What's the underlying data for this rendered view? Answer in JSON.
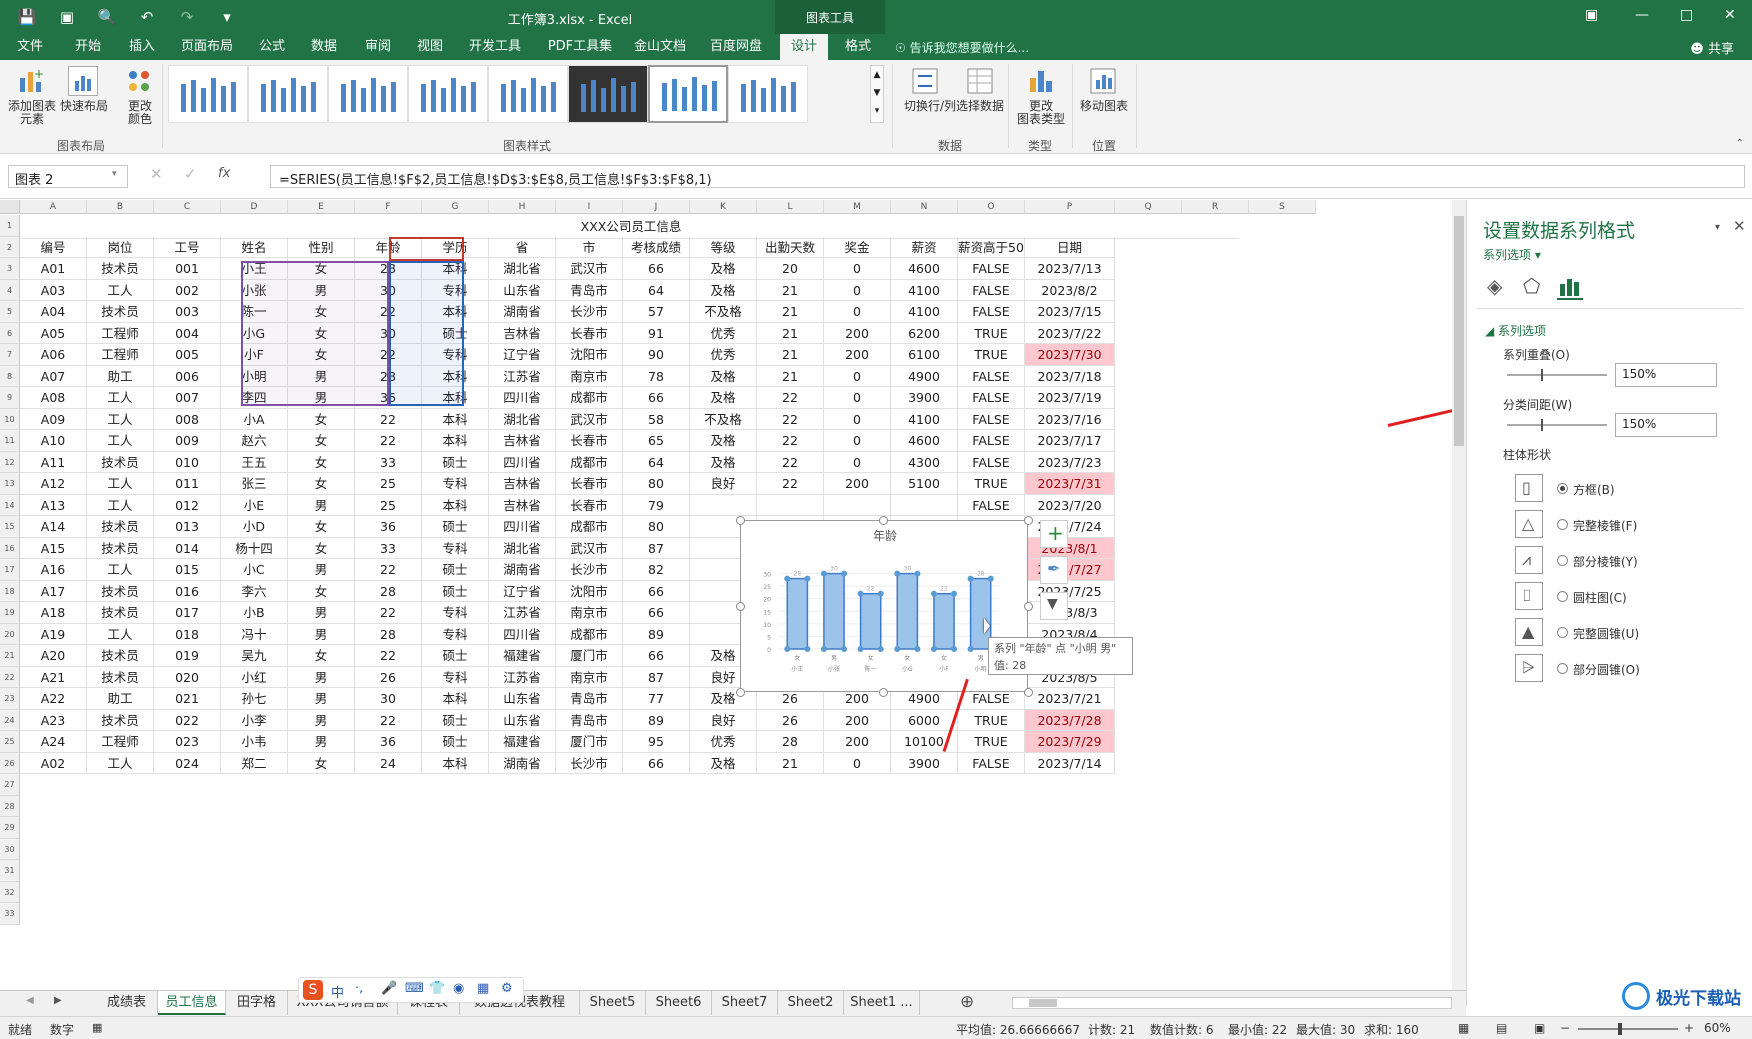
{
  "titlebar": {
    "doc_title": "工作簿3.xlsx - Excel",
    "context_tools": "图表工具"
  },
  "menu": [
    "文件",
    "开始",
    "插入",
    "页面布局",
    "公式",
    "数据",
    "审阅",
    "视图",
    "开发工具",
    "PDF工具集",
    "金山文档",
    "百度网盘",
    "设计",
    "格式"
  ],
  "tell_me": "告诉我您想要做什么...",
  "share": "共享",
  "ribbon": {
    "add_element": "添加图表\n元素",
    "quick_layout": "快速布局",
    "change_colors": "更改\n颜色",
    "group_layout": "图表布局",
    "group_styles": "图表样式",
    "switch_rowcol": "切换行/列",
    "select_data": "选择数据",
    "group_data": "数据",
    "change_type": "更改\n图表类型",
    "group_type": "类型",
    "move_chart": "移动图表",
    "group_location": "位置"
  },
  "formula": {
    "name_box": "图表 2",
    "fx": "fx",
    "text": "=SERIES(员工信息!$F$2,员工信息!$D$3:$E$8,员工信息!$F$3:$F$8,1)"
  },
  "columns": [
    "A",
    "B",
    "C",
    "D",
    "E",
    "F",
    "G",
    "H",
    "I",
    "J",
    "K",
    "L",
    "M",
    "N",
    "O",
    "P",
    "Q",
    "R",
    "S"
  ],
  "sheet_title": "XXX公司员工信息",
  "headers": [
    "编号",
    "岗位",
    "工号",
    "姓名",
    "性别",
    "年龄",
    "学历",
    "省",
    "市",
    "考核成绩",
    "等级",
    "出勤天数",
    "奖金",
    "薪资",
    "薪资高于5000",
    "日期"
  ],
  "rows": [
    [
      "A01",
      "技术员",
      "001",
      "小王",
      "女",
      "28",
      "本科",
      "湖北省",
      "武汉市",
      "66",
      "及格",
      "20",
      "0",
      "4600",
      "FALSE",
      "2023/7/13"
    ],
    [
      "A03",
      "工人",
      "002",
      "小张",
      "男",
      "30",
      "专科",
      "山东省",
      "青岛市",
      "64",
      "及格",
      "21",
      "0",
      "4100",
      "FALSE",
      "2023/8/2"
    ],
    [
      "A04",
      "技术员",
      "003",
      "陈一",
      "女",
      "22",
      "本科",
      "湖南省",
      "长沙市",
      "57",
      "不及格",
      "21",
      "0",
      "4100",
      "FALSE",
      "2023/7/15"
    ],
    [
      "A05",
      "工程师",
      "004",
      "小G",
      "女",
      "30",
      "硕士",
      "吉林省",
      "长春市",
      "91",
      "优秀",
      "21",
      "200",
      "6200",
      "TRUE",
      "2023/7/22"
    ],
    [
      "A06",
      "工程师",
      "005",
      "小F",
      "女",
      "22",
      "专科",
      "辽宁省",
      "沈阳市",
      "90",
      "优秀",
      "21",
      "200",
      "6100",
      "TRUE",
      "2023/7/30"
    ],
    [
      "A07",
      "助工",
      "006",
      "小明",
      "男",
      "28",
      "本科",
      "江苏省",
      "南京市",
      "78",
      "及格",
      "21",
      "0",
      "4900",
      "FALSE",
      "2023/7/18"
    ],
    [
      "A08",
      "工人",
      "007",
      "李四",
      "男",
      "36",
      "本科",
      "四川省",
      "成都市",
      "66",
      "及格",
      "22",
      "0",
      "3900",
      "FALSE",
      "2023/7/19"
    ],
    [
      "A09",
      "工人",
      "008",
      "小A",
      "女",
      "22",
      "本科",
      "湖北省",
      "武汉市",
      "58",
      "不及格",
      "22",
      "0",
      "4100",
      "FALSE",
      "2023/7/16"
    ],
    [
      "A10",
      "工人",
      "009",
      "赵六",
      "女",
      "22",
      "本科",
      "吉林省",
      "长春市",
      "65",
      "及格",
      "22",
      "0",
      "4600",
      "FALSE",
      "2023/7/17"
    ],
    [
      "A11",
      "技术员",
      "010",
      "王五",
      "女",
      "33",
      "硕士",
      "四川省",
      "成都市",
      "64",
      "及格",
      "22",
      "0",
      "4300",
      "FALSE",
      "2023/7/23"
    ],
    [
      "A12",
      "工人",
      "011",
      "张三",
      "女",
      "25",
      "专科",
      "吉林省",
      "长春市",
      "80",
      "良好",
      "22",
      "200",
      "5100",
      "TRUE",
      "2023/7/31"
    ],
    [
      "A13",
      "工人",
      "012",
      "小E",
      "男",
      "25",
      "本科",
      "吉林省",
      "长春市",
      "79",
      "",
      "",
      "",
      "",
      "FALSE",
      "2023/7/20"
    ],
    [
      "A14",
      "技术员",
      "013",
      "小D",
      "女",
      "36",
      "硕士",
      "四川省",
      "成都市",
      "80",
      "",
      "",
      "",
      "",
      "TRUE",
      "2023/7/24"
    ],
    [
      "A15",
      "技术员",
      "014",
      "杨十四",
      "女",
      "33",
      "专科",
      "湖北省",
      "武汉市",
      "87",
      "",
      "",
      "",
      "",
      "TRUE",
      "2023/8/1"
    ],
    [
      "A16",
      "工人",
      "015",
      "小C",
      "男",
      "22",
      "硕士",
      "湖南省",
      "长沙市",
      "82",
      "",
      "",
      "",
      "",
      "FALSE",
      "2023/7/27"
    ],
    [
      "A17",
      "技术员",
      "016",
      "李六",
      "女",
      "28",
      "硕士",
      "辽宁省",
      "沈阳市",
      "66",
      "",
      "",
      "",
      "",
      "FALSE",
      "2023/7/25"
    ],
    [
      "A18",
      "技术员",
      "017",
      "小B",
      "男",
      "22",
      "专科",
      "江苏省",
      "南京市",
      "66",
      "",
      "",
      "",
      "",
      "FALSE",
      "2023/8/3"
    ],
    [
      "A19",
      "工人",
      "018",
      "冯十",
      "男",
      "28",
      "专科",
      "四川省",
      "成都市",
      "89",
      "",
      "",
      "",
      "",
      "TRUE",
      "2023/8/4"
    ],
    [
      "A20",
      "技术员",
      "019",
      "吴九",
      "女",
      "22",
      "硕士",
      "福建省",
      "厦门市",
      "66",
      "及格",
      "25",
      "0",
      "4600",
      "FALSE",
      "2023/7/26"
    ],
    [
      "A21",
      "技术员",
      "020",
      "小红",
      "男",
      "26",
      "专科",
      "江苏省",
      "南京市",
      "87",
      "良好",
      "21",
      "200",
      "5900",
      "TRUE",
      "2023/8/5"
    ],
    [
      "A22",
      "助工",
      "021",
      "孙七",
      "男",
      "30",
      "本科",
      "山东省",
      "青岛市",
      "77",
      "及格",
      "26",
      "200",
      "4900",
      "FALSE",
      "2023/7/21"
    ],
    [
      "A23",
      "技术员",
      "022",
      "小李",
      "男",
      "22",
      "硕士",
      "山东省",
      "青岛市",
      "89",
      "良好",
      "26",
      "200",
      "6000",
      "TRUE",
      "2023/7/28"
    ],
    [
      "A24",
      "工程师",
      "023",
      "小韦",
      "男",
      "36",
      "硕士",
      "福建省",
      "厦门市",
      "95",
      "优秀",
      "28",
      "200",
      "10100",
      "TRUE",
      "2023/7/29"
    ],
    [
      "A02",
      "工人",
      "024",
      "郑二",
      "女",
      "24",
      "本科",
      "湖南省",
      "长沙市",
      "66",
      "及格",
      "21",
      "0",
      "3900",
      "FALSE",
      "2023/7/14"
    ]
  ],
  "pink_dates": [
    4,
    10,
    13,
    14,
    18,
    21,
    22
  ],
  "chart_data": {
    "type": "bar",
    "title": "年龄",
    "categories": [
      "小王 女",
      "小张 男",
      "陈一 女",
      "小G 女",
      "小F 女",
      "小明 男"
    ],
    "values": [
      28,
      30,
      22,
      30,
      22,
      28
    ],
    "ylim": [
      0,
      35
    ],
    "yticks": [
      0,
      5,
      10,
      15,
      20,
      25,
      30
    ]
  },
  "tooltip": {
    "line1": "系列 \"年龄\" 点 \"小明 男\"",
    "line2": "值: 28"
  },
  "pane": {
    "title": "设置数据系列格式",
    "dropdown": "系列选项",
    "section": "系列选项",
    "overlap_label": "系列重叠(O)",
    "overlap_value": "150%",
    "gap_label": "分类间距(W)",
    "gap_value": "150%",
    "shape_title": "柱体形状",
    "shapes": [
      "方框(B)",
      "完整棱锥(F)",
      "部分棱锥(Y)",
      "圆柱图(C)",
      "完整圆锥(U)",
      "部分圆锥(O)"
    ]
  },
  "tabs": [
    "成绩表",
    "员工信息",
    "田字格",
    "XXX公司销售额",
    "课程表",
    "数据透视表教程",
    "Sheet5",
    "Sheet6",
    "Sheet7",
    "Sheet2",
    "Sheet1 ..."
  ],
  "status": {
    "ready": "就绪",
    "numeric": "数字",
    "avg": "平均值: 26.66666667",
    "count": "计数: 21",
    "num_count": "数值计数: 6",
    "min": "最小值: 22",
    "max": "最大值: 30",
    "sum": "求和: 160",
    "zoom": "60%"
  },
  "watermark": "极光下载站"
}
